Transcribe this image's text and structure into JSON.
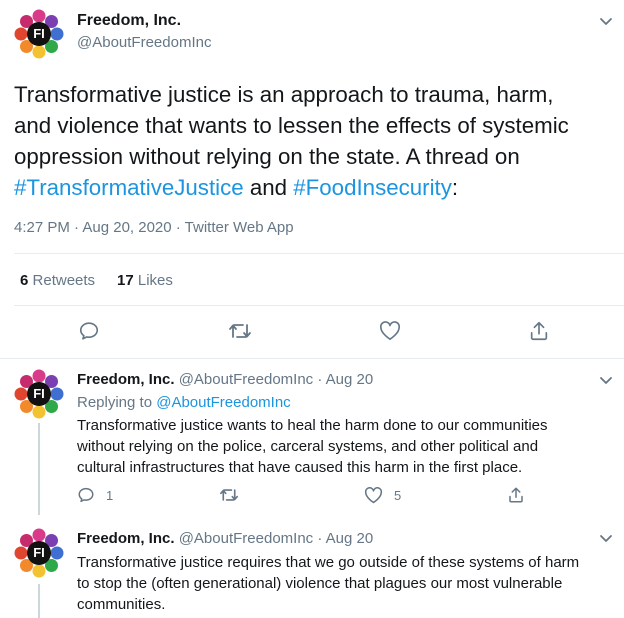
{
  "main_tweet": {
    "author_name": "Freedom, Inc.",
    "handle": "@AboutFreedomInc",
    "logo_text": "FI",
    "text_1": "Transformative justice is an approach to trauma, harm,",
    "text_2": "and violence that wants to lessen the effects of systemic",
    "text_3": "oppression without relying on the state. A thread on",
    "hashtag_1": "#TransformativeJustice",
    "text_and": " and ",
    "hashtag_2": "#FoodInsecurity",
    "text_end": ":",
    "timestamp": "4:27 PM · Aug 20, 2020 · Twitter Web App",
    "retweets_count": "6",
    "retweets_label": "Retweets",
    "likes_count": "17",
    "likes_label": "Likes"
  },
  "replies": [
    {
      "author_name": "Freedom, Inc.",
      "meta": "@AboutFreedomInc · Aug 20",
      "replying_prefix": "Replying to ",
      "replying_handle": "@AboutFreedomInc",
      "line_1": "Transformative justice wants to heal the harm done to our communities",
      "line_2": "without relying on the police, carceral systems, and other political and",
      "line_3": "cultural infrastructures that have caused this harm in the first place.",
      "reply_count": "1",
      "like_count": "5"
    },
    {
      "author_name": "Freedom, Inc.",
      "meta": "@AboutFreedomInc · Aug 20",
      "line_1": "Transformative justice requires that we go outside of these systems of harm",
      "line_2": "to stop the (often generational) violence that plagues our most vulnerable",
      "line_3": "communities."
    }
  ],
  "colors": {
    "link": "#1b95e0",
    "muted": "#657786",
    "divider": "#e6ecf0"
  }
}
